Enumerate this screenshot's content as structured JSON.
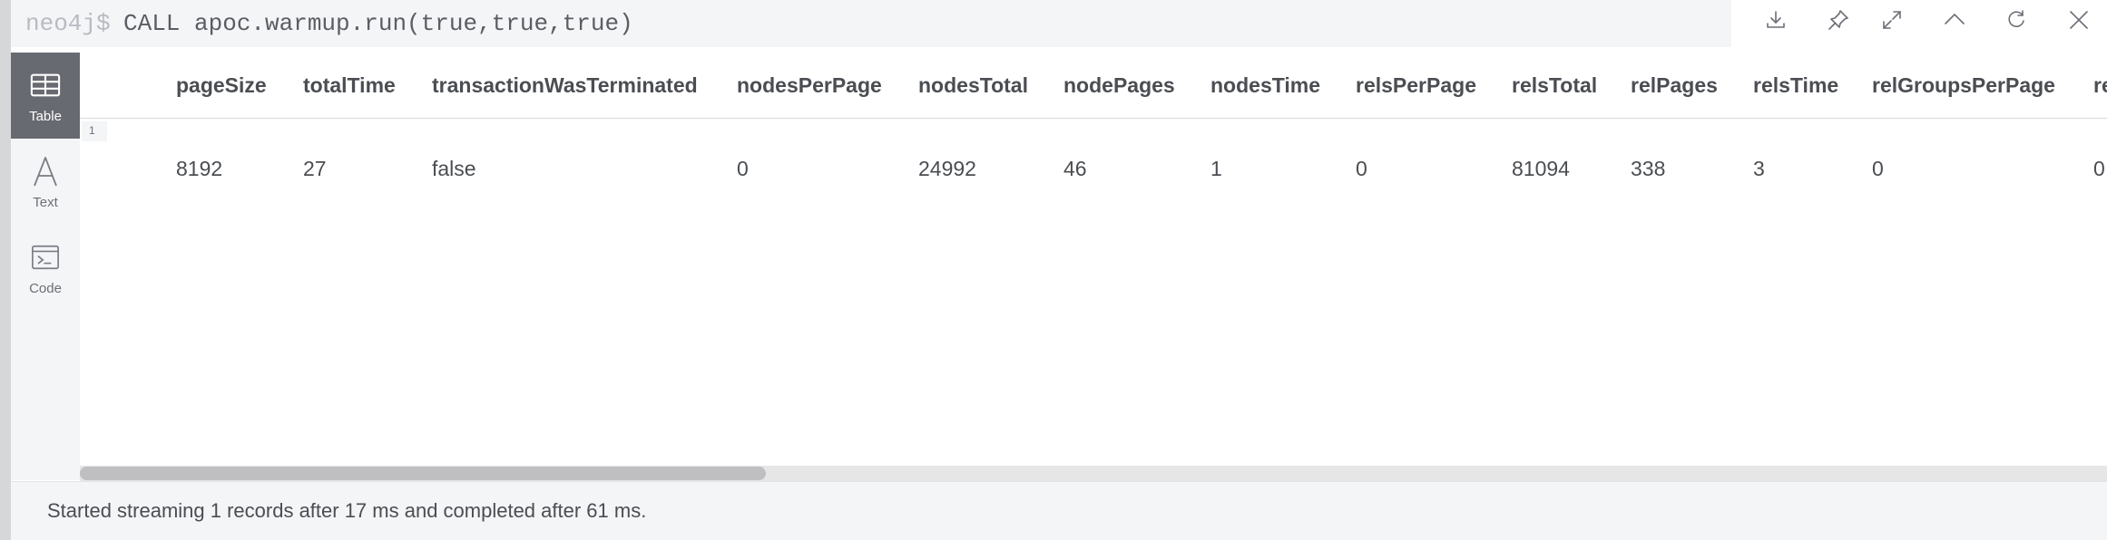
{
  "command": {
    "prompt": "neo4j$",
    "query": "CALL apoc.warmup.run(true,true,true)"
  },
  "header_actions": [
    {
      "id": "download",
      "icon": "download-icon"
    },
    {
      "id": "pin",
      "icon": "pin-icon"
    },
    {
      "id": "expand",
      "icon": "expand-icon"
    },
    {
      "id": "collapse",
      "icon": "chevron-up-icon"
    },
    {
      "id": "rerun",
      "icon": "refresh-icon"
    },
    {
      "id": "close",
      "icon": "close-icon"
    }
  ],
  "nav": {
    "items": [
      {
        "label": "Table",
        "icon": "table-icon",
        "active": true
      },
      {
        "label": "Text",
        "icon": "text-icon",
        "active": false
      },
      {
        "label": "Code",
        "icon": "code-icon",
        "active": false
      }
    ]
  },
  "table": {
    "columns": [
      "pageSize",
      "totalTime",
      "transactionWasTerminated",
      "nodesPerPage",
      "nodesTotal",
      "nodePages",
      "nodesTime",
      "relsPerPage",
      "relsTotal",
      "relPages",
      "relsTime",
      "relGroupsPerPage",
      "re"
    ],
    "rows": [
      {
        "index": "1",
        "cells": [
          "8192",
          "27",
          "false",
          "0",
          "24992",
          "46",
          "1",
          "0",
          "81094",
          "338",
          "3",
          "0",
          "0"
        ]
      }
    ]
  },
  "footer": {
    "status": "Started streaming 1 records after 17 ms and completed after 61 ms."
  },
  "colors": {
    "panel": "#f4f5f7",
    "nav_active": "#676a70",
    "text": "#4a4d52",
    "prompt": "#b8bbc1"
  }
}
